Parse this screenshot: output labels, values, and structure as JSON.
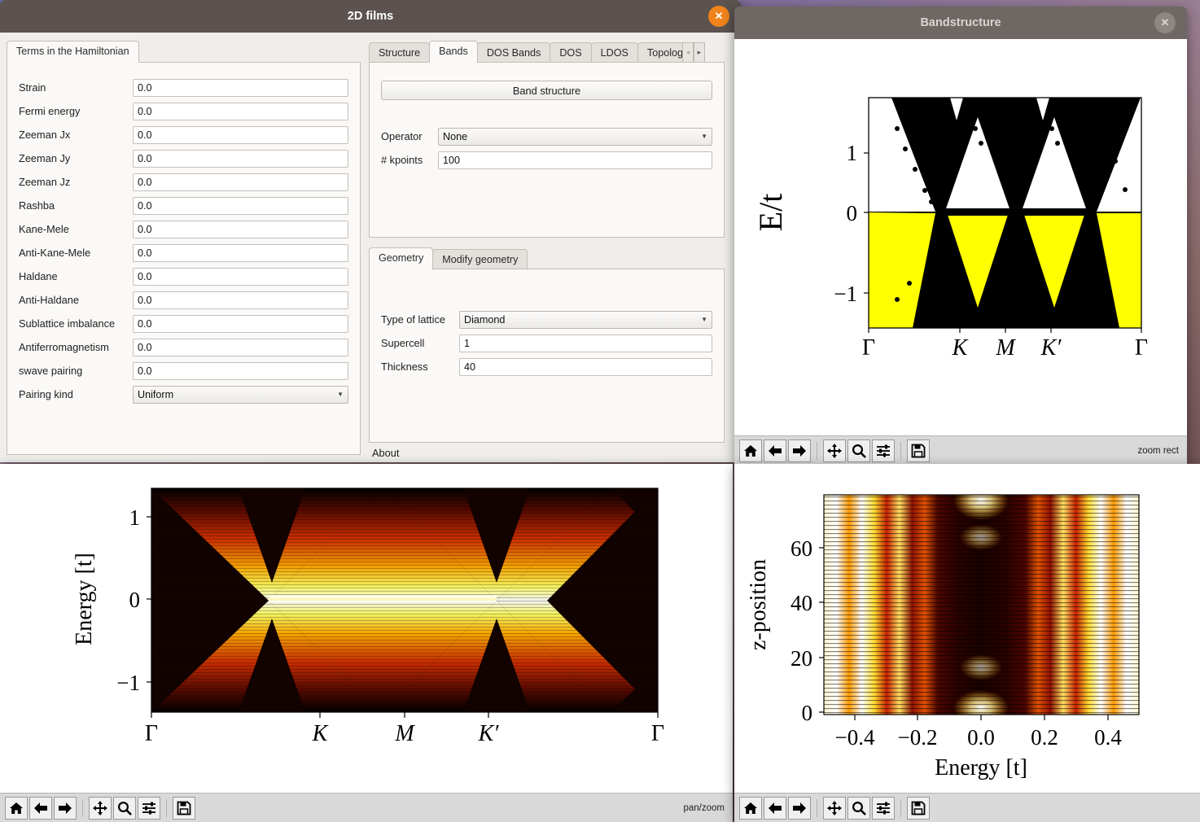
{
  "desktop": {
    "accent": "#f0831b"
  },
  "films_window": {
    "title": "2D films",
    "close_label": "✕",
    "left_panel": {
      "tab_label": "Terms in the Hamiltonian",
      "fields": [
        {
          "label": "Strain",
          "value": "0.0",
          "type": "input"
        },
        {
          "label": "Fermi energy",
          "value": "0.0",
          "type": "input"
        },
        {
          "label": "Zeeman Jx",
          "value": "0.0",
          "type": "input"
        },
        {
          "label": "Zeeman Jy",
          "value": "0.0",
          "type": "input"
        },
        {
          "label": "Zeeman Jz",
          "value": "0.0",
          "type": "input"
        },
        {
          "label": "Rashba",
          "value": "0.0",
          "type": "input"
        },
        {
          "label": "Kane-Mele",
          "value": "0.0",
          "type": "input"
        },
        {
          "label": "Anti-Kane-Mele",
          "value": "0.0",
          "type": "input"
        },
        {
          "label": "Haldane",
          "value": "0.0",
          "type": "input"
        },
        {
          "label": "Anti-Haldane",
          "value": "0.0",
          "type": "input"
        },
        {
          "label": "Sublattice imbalance",
          "value": "0.0",
          "type": "input"
        },
        {
          "label": "Antiferromagnetism",
          "value": "0.0",
          "type": "input"
        },
        {
          "label": "swave pairing",
          "value": "0.0",
          "type": "input"
        },
        {
          "label": "Pairing kind",
          "value": "Uniform",
          "type": "select"
        }
      ]
    },
    "right_panel": {
      "tabs": [
        {
          "label": "Structure",
          "selected": false
        },
        {
          "label": "Bands",
          "selected": true
        },
        {
          "label": "DOS Bands",
          "selected": false
        },
        {
          "label": "DOS",
          "selected": false
        },
        {
          "label": "LDOS",
          "selected": false
        },
        {
          "label": "Topology",
          "selected": false
        }
      ],
      "scroll_left": "◂",
      "scroll_right": "▸",
      "band_structure_button": "Band structure",
      "operator_label": "Operator",
      "operator_value": "None",
      "kpoints_label": "# kpoints",
      "kpoints_value": "100",
      "geometry_tabs": [
        {
          "label": "Geometry",
          "selected": true
        },
        {
          "label": "Modify geometry",
          "selected": false
        }
      ],
      "lattice_label": "Type of lattice",
      "lattice_value": "Diamond",
      "supercell_label": "Supercell",
      "supercell_value": "1",
      "thickness_label": "Thickness",
      "thickness_value": "40",
      "about_label": "About"
    }
  },
  "band_window": {
    "title": "Bandstructure",
    "close_label": "✕",
    "toolbar_message": "zoom rect",
    "toolbar": [
      {
        "name": "home-icon",
        "title": "Home"
      },
      {
        "name": "back-arrow-icon",
        "title": "Back"
      },
      {
        "name": "forward-arrow-icon",
        "title": "Forward"
      },
      {
        "name": "pan-move-icon",
        "title": "Pan"
      },
      {
        "name": "magnifier-icon",
        "title": "Zoom"
      },
      {
        "name": "sliders-icon",
        "title": "Configure subplots"
      },
      {
        "name": "floppy-save-icon",
        "title": "Save"
      }
    ]
  },
  "dosband_window": {
    "toolbar_message": "pan/zoom",
    "toolbar": [
      {
        "name": "home-icon",
        "title": "Home"
      },
      {
        "name": "back-arrow-icon",
        "title": "Back"
      },
      {
        "name": "forward-arrow-icon",
        "title": "Forward"
      },
      {
        "name": "pan-move-icon",
        "title": "Pan"
      },
      {
        "name": "magnifier-icon",
        "title": "Zoom"
      },
      {
        "name": "sliders-icon",
        "title": "Configure subplots"
      },
      {
        "name": "floppy-save-icon",
        "title": "Save"
      }
    ]
  },
  "ldos_window": {
    "toolbar_message": "",
    "toolbar": [
      {
        "name": "home-icon",
        "title": "Home"
      },
      {
        "name": "back-arrow-icon",
        "title": "Back"
      },
      {
        "name": "forward-arrow-icon",
        "title": "Forward"
      },
      {
        "name": "pan-move-icon",
        "title": "Pan"
      },
      {
        "name": "magnifier-icon",
        "title": "Zoom"
      },
      {
        "name": "sliders-icon",
        "title": "Configure subplots"
      },
      {
        "name": "floppy-save-icon",
        "title": "Save"
      }
    ]
  },
  "chart_data": [
    {
      "id": "bandstructure",
      "type": "line",
      "title": "",
      "xlabel": "",
      "ylabel": "E/t",
      "xticklabels": [
        "Γ",
        "K",
        "M",
        "K′",
        "Γ"
      ],
      "xtickpos": [
        0.0,
        0.333,
        0.5,
        0.667,
        1.0
      ],
      "yticklabels": [
        "1",
        "0",
        "−1"
      ],
      "ytickvals": [
        1,
        0,
        -1
      ],
      "ylim": [
        -1.45,
        1.45
      ],
      "xlim": [
        0,
        1
      ],
      "grid": false,
      "legend": null,
      "band_color": "#000000",
      "occupied_fill_color": "#ffff00",
      "background_color": "#ffffff",
      "description": "Dense bulk band continuum of a 40-layer diamond film along Γ-K-M-K'-Γ; states below E=0 shaded yellow (occupied); flat zero-energy surface band between K and K'."
    },
    {
      "id": "dos_bands",
      "type": "heatmap",
      "title": "",
      "xlabel": "",
      "ylabel": "Energy [t]",
      "xticklabels": [
        "Γ",
        "K",
        "M",
        "K′",
        "Γ"
      ],
      "xtickpos": [
        0.0,
        0.333,
        0.5,
        0.667,
        1.0
      ],
      "yticklabels": [
        "1",
        "0",
        "−1"
      ],
      "ytickvals": [
        1,
        0,
        -1
      ],
      "ylim": [
        -1.45,
        1.45
      ],
      "xlim": [
        0,
        1
      ],
      "colormap": "hot (black-red-orange-yellow-white)",
      "grid": false,
      "description": "Spectral function A(k,E) along Γ-K-M-K'-Γ showing Dirac cones at K and K' and a flat zero-energy surface state connecting them."
    },
    {
      "id": "ldos",
      "type": "heatmap",
      "title": "",
      "xlabel": "Energy [t]",
      "ylabel": "z-position",
      "xticklabels": [
        "−0.4",
        "−0.2",
        "0.0",
        "0.2",
        "0.4"
      ],
      "xtickvals": [
        -0.4,
        -0.2,
        0.0,
        0.2,
        0.4
      ],
      "yticklabels": [
        "0",
        "20",
        "40",
        "60"
      ],
      "ytickvals": [
        0,
        20,
        40,
        60
      ],
      "xlim": [
        -0.5,
        0.5
      ],
      "ylim": [
        0,
        78
      ],
      "colormap": "hot (black-red-orange-yellow-white)",
      "grid": false,
      "description": "Layer-resolved local density of states versus energy; bright surface-localised peak at E=0 near z=0 and z=78, dark gap region around zero in the bulk."
    }
  ]
}
